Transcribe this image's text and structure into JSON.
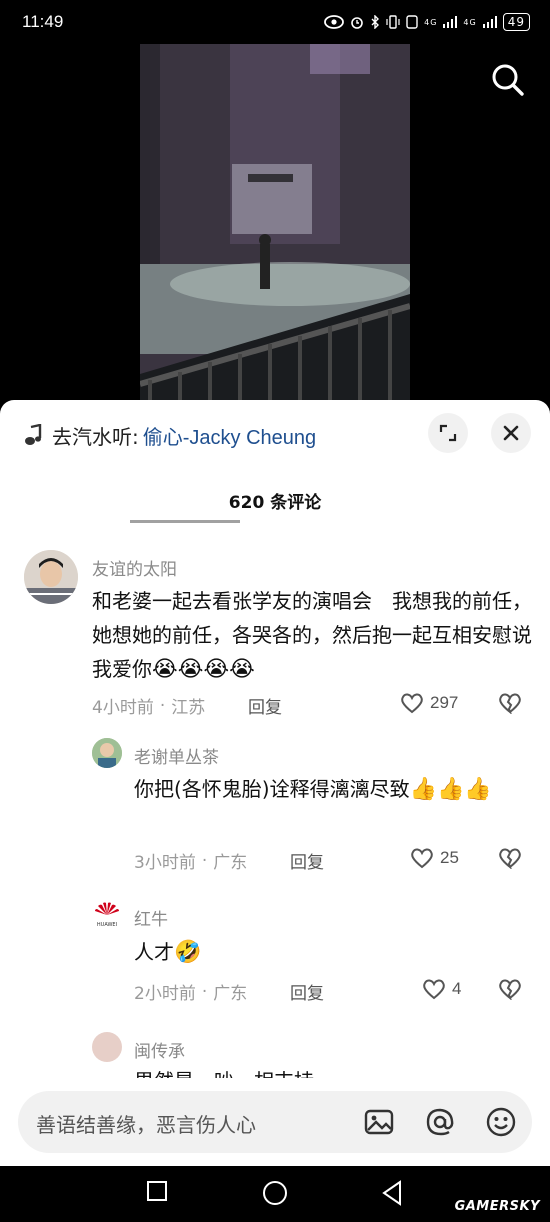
{
  "status_bar": {
    "time": "11:49",
    "signal_1": "4G",
    "signal_2": "4G",
    "battery": "49"
  },
  "music": {
    "prefix": "去汽水听:",
    "song": "偷心-Jacky Cheung"
  },
  "comments_header": {
    "title": "620 条评论"
  },
  "comments": [
    {
      "user": "友谊的太阳",
      "text": "和老婆一起去看张学友的演唱会　我想我的前任，她想她的前任，各哭各的，然后抱一起互相安慰说我爱你",
      "emojis": [
        "😭",
        "😭",
        "😭",
        "😭"
      ],
      "time": "4小时前",
      "location": "江苏",
      "reply_label": "回复",
      "likes": "297"
    }
  ],
  "replies": [
    {
      "user": "老谢单丛茶",
      "text": "你把(各怀鬼胎)诠释得漓漓尽致",
      "emojis": [
        "👍",
        "👍",
        "👍"
      ],
      "time": "3小时前",
      "location": "广东",
      "reply_label": "回复",
      "likes": "25"
    },
    {
      "user": "红牛",
      "text": "人才",
      "emojis": [
        "🤣"
      ],
      "time": "2小时前",
      "location": "广东",
      "reply_label": "回复",
      "likes": "4"
    },
    {
      "user": "闽传承",
      "text": "男然是一吵一相支持"
    }
  ],
  "input": {
    "placeholder": "善语结善缘，恶言伤人心"
  },
  "watermark": "GAMERSKY",
  "avatar_logo_text": "HUAWEI"
}
